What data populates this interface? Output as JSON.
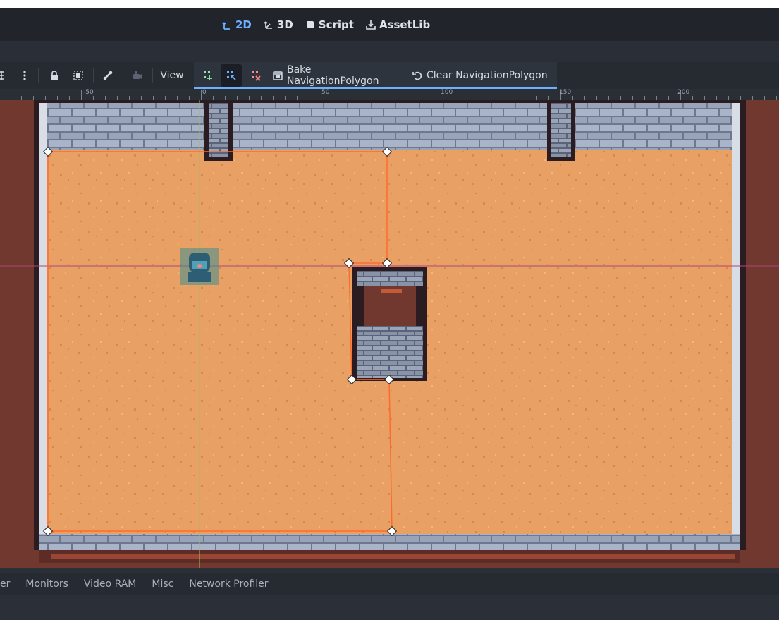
{
  "mode_tabs": [
    {
      "label": "2D",
      "icon": "2d-transform-icon",
      "active": true
    },
    {
      "label": "3D",
      "icon": "3d-transform-icon",
      "active": false
    },
    {
      "label": "Script",
      "icon": "script-icon",
      "active": false
    },
    {
      "label": "AssetLib",
      "icon": "download-icon",
      "active": false
    }
  ],
  "toolbar": {
    "view_label": "View",
    "bake_label": "Bake NavigationPolygon",
    "clear_label": "Clear NavigationPolygon"
  },
  "ruler": {
    "labels": [
      "-50",
      "0",
      "50",
      "100",
      "150",
      "200"
    ]
  },
  "bottom_tabs": [
    "er",
    "Monitors",
    "Video RAM",
    "Misc",
    "Network Profiler"
  ],
  "colors": {
    "accent": "#6cb0ff",
    "nav_polygon_outline": "#ff6a2a",
    "floor": "#e8a065",
    "wall_outside": "#70382f",
    "stone": "#8f9ab0"
  }
}
